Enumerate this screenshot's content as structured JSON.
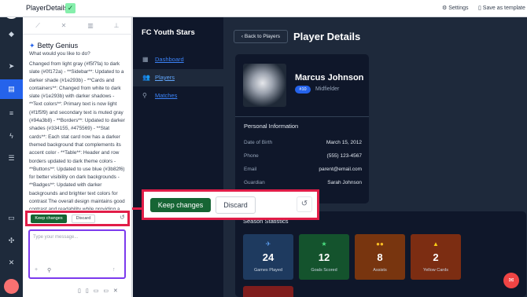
{
  "topbar": {
    "title": "PlayerDetails",
    "settings_label": "⚙ Settings",
    "save_template_label": "▯ Save as template"
  },
  "chat": {
    "agent_name": "Betty Genius",
    "question": "What would you like to do?",
    "message": "Changed from light gray (#f5f7fa) to dark slate (#0f172a) - **Sidebar**: Updated to a darker shade (#1e293b) - **Cards and containers**: Changed from white to dark slate (#1e293b) with darker shadows - **Text colors**: Primary text is now light (#f1f5f9) and secondary text is muted gray (#94a3b8) - **Borders**: Updated to darker shades (#334155, #475569) - **Stat cards**: Each stat card now has a darker themed background that complements its accent color - **Table**: Header and row borders updated to dark theme colors - **Buttons**: Updated to use blue (#3b82f6) for better visibility on dark backgrounds - **Badges**: Updated with darker backgrounds and brighter text colors for contrast The overall design maintains good contrast and readability while providing a cohesive dark mode experience.",
    "keep_label": "Keep changes",
    "discard_label": "Discard",
    "input_placeholder": "Type your message..."
  },
  "callout": {
    "keep_label": "Keep changes",
    "discard_label": "Discard"
  },
  "app": {
    "brand": "FC Youth Stars",
    "nav": [
      {
        "label": "Dashboard",
        "icon": "grid-icon"
      },
      {
        "label": "Players",
        "icon": "users-icon"
      },
      {
        "label": "Matches",
        "icon": "whistle-icon"
      }
    ]
  },
  "main": {
    "back_label": "‹ Back to Players",
    "page_title": "Player Details",
    "player": {
      "name": "Marcus Johnson",
      "number": "#10",
      "position": "Midfielder"
    },
    "personal_title": "Personal Information",
    "info": [
      {
        "key": "Date of Birth",
        "value": "March 15, 2012"
      },
      {
        "key": "Phone",
        "value": "(555) 123-4567"
      },
      {
        "key": "Email",
        "value": "parent@email.com"
      },
      {
        "key": "Guardian",
        "value": "Sarah Johnson"
      }
    ],
    "stats_title": "Season Statistics",
    "stats": [
      {
        "value": "24",
        "label": "Games Played",
        "icon": "runner-icon",
        "bg": "#1e3a5f",
        "accent": "#60a5fa"
      },
      {
        "value": "12",
        "label": "Goals Scored",
        "icon": "star-icon",
        "bg": "#14532d",
        "accent": "#4ade80"
      },
      {
        "value": "8",
        "label": "Assists",
        "icon": "team-icon",
        "bg": "#78350f",
        "accent": "#fbbf24"
      },
      {
        "value": "2",
        "label": "Yellow Cards",
        "icon": "warning-icon",
        "bg": "#7c2d12",
        "accent": "#facc15"
      }
    ]
  }
}
